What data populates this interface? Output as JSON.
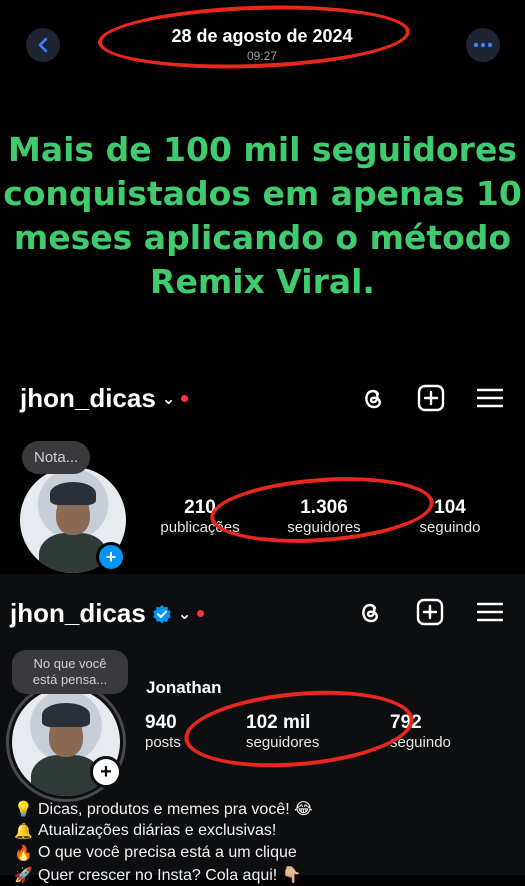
{
  "topbar": {
    "date": "28 de agosto de 2024",
    "time": "09:27",
    "back_icon": "chevron-left-icon",
    "more_icon": "more-horizontal-icon"
  },
  "headline": {
    "lines": [
      "Mais de 100 mil seguidores",
      "conquistados em apenas 10",
      "meses aplicando o método",
      "Remix Viral."
    ],
    "color": "#3fcb6e"
  },
  "before": {
    "username": "jhon_dicas",
    "note": "Nota...",
    "stats": [
      {
        "value": "210",
        "label": "publicações"
      },
      {
        "value": "1.306",
        "label": "seguidores"
      },
      {
        "value": "104",
        "label": "seguindo"
      }
    ]
  },
  "after": {
    "username": "jhon_dicas",
    "note": "No que você está pensa...",
    "name": "Jonathan",
    "stats": [
      {
        "value": "940",
        "label": "posts"
      },
      {
        "value": "102 mil",
        "label": "seguidores"
      },
      {
        "value": "792",
        "label": "seguindo"
      }
    ],
    "bio": [
      {
        "emoji": "💡",
        "text": "Dicas, produtos e memes pra você! 😂"
      },
      {
        "emoji": "🔔",
        "text": "Atualizações diárias e exclusivas!"
      },
      {
        "emoji": "🔥",
        "text": "O que você precisa está a um clique"
      },
      {
        "emoji": "🚀",
        "text": "Quer crescer no Insta? Cola aqui! 👇🏼"
      }
    ]
  },
  "colors": {
    "marker": "#e8271f",
    "verified": "#0095f6",
    "notification_dot": "#ff3040"
  }
}
